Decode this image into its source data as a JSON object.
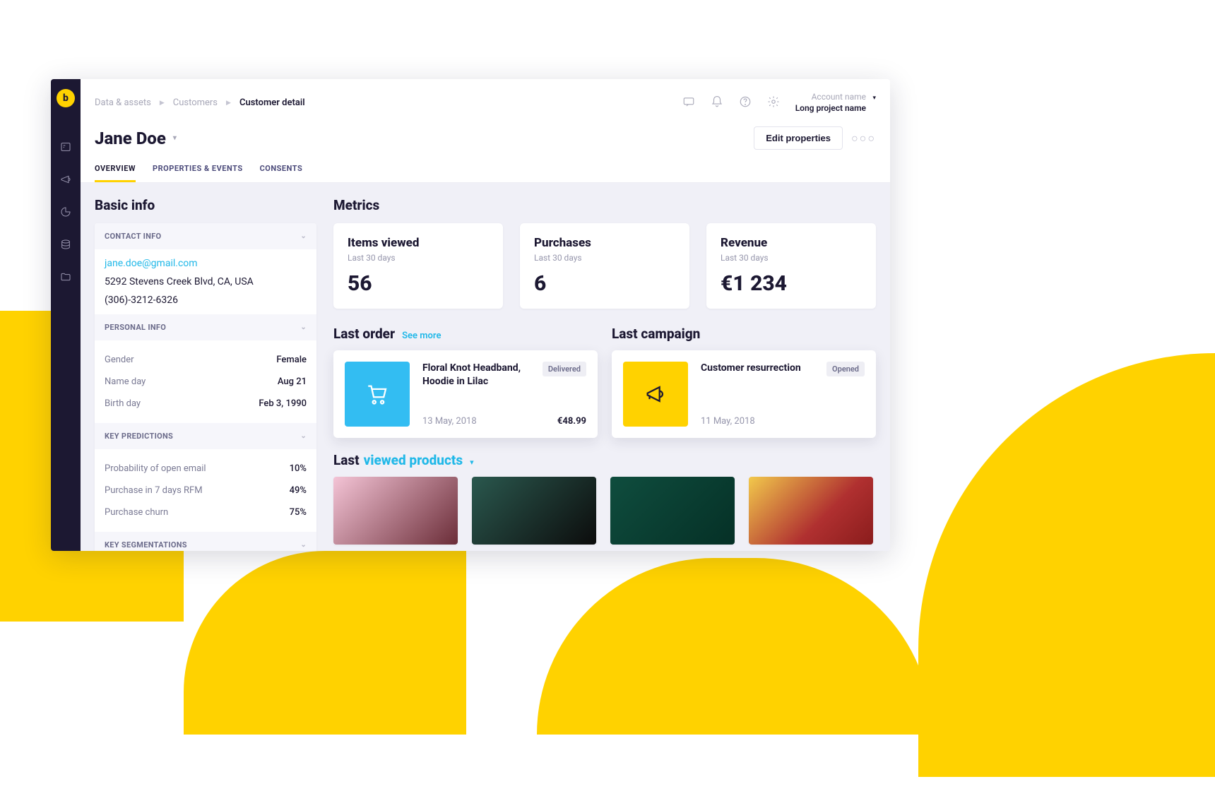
{
  "breadcrumb": {
    "lvl1": "Data & assets",
    "lvl2": "Customers",
    "lvl3": "Customer detail"
  },
  "account": {
    "name": "Account name",
    "project": "Long project name"
  },
  "pageTitle": "Jane Doe",
  "actions": {
    "editProperties": "Edit properties"
  },
  "tabs": {
    "overview": "OVERVIEW",
    "properties": "PROPERTIES & EVENTS",
    "consents": "CONSENTS"
  },
  "basicInfo": {
    "title": "Basic info",
    "contactInfo": {
      "header": "CONTACT INFO",
      "email": "jane.doe@gmail.com",
      "address": "5292 Stevens Creek Blvd, CA, USA",
      "phone": "(306)-3212-6326"
    },
    "personalInfo": {
      "header": "PERSONAL INFO",
      "rows": [
        {
          "k": "Gender",
          "v": "Female"
        },
        {
          "k": "Name day",
          "v": "Aug 21"
        },
        {
          "k": "Birth day",
          "v": "Feb 3, 1990"
        }
      ]
    },
    "keyPredictions": {
      "header": "KEY PREDICTIONS",
      "rows": [
        {
          "k": "Probability of open email",
          "v": "10%"
        },
        {
          "k": "Purchase in 7 days RFM",
          "v": "49%"
        },
        {
          "k": "Purchase churn",
          "v": "75%"
        }
      ]
    },
    "keySegmentations": {
      "header": "KEY SEGMENTATIONS"
    }
  },
  "metrics": {
    "title": "Metrics",
    "cards": [
      {
        "label": "Items viewed",
        "period": "Last 30 days",
        "value": "56"
      },
      {
        "label": "Purchases",
        "period": "Last 30 days",
        "value": "6"
      },
      {
        "label": "Revenue",
        "period": "Last 30 days",
        "value": "€1 234"
      }
    ]
  },
  "lastOrder": {
    "title": "Last order",
    "seeMore": "See more",
    "name": "Floral Knot Headband, Hoodie in Lilac",
    "badge": "Delivered",
    "date": "13 May, 2018",
    "price": "€48.99"
  },
  "lastCampaign": {
    "title": "Last campaign",
    "name": "Customer resurrection",
    "badge": "Opened",
    "date": "11 May, 2018"
  },
  "lastProducts": {
    "prefix": "Last",
    "link": "viewed products"
  }
}
